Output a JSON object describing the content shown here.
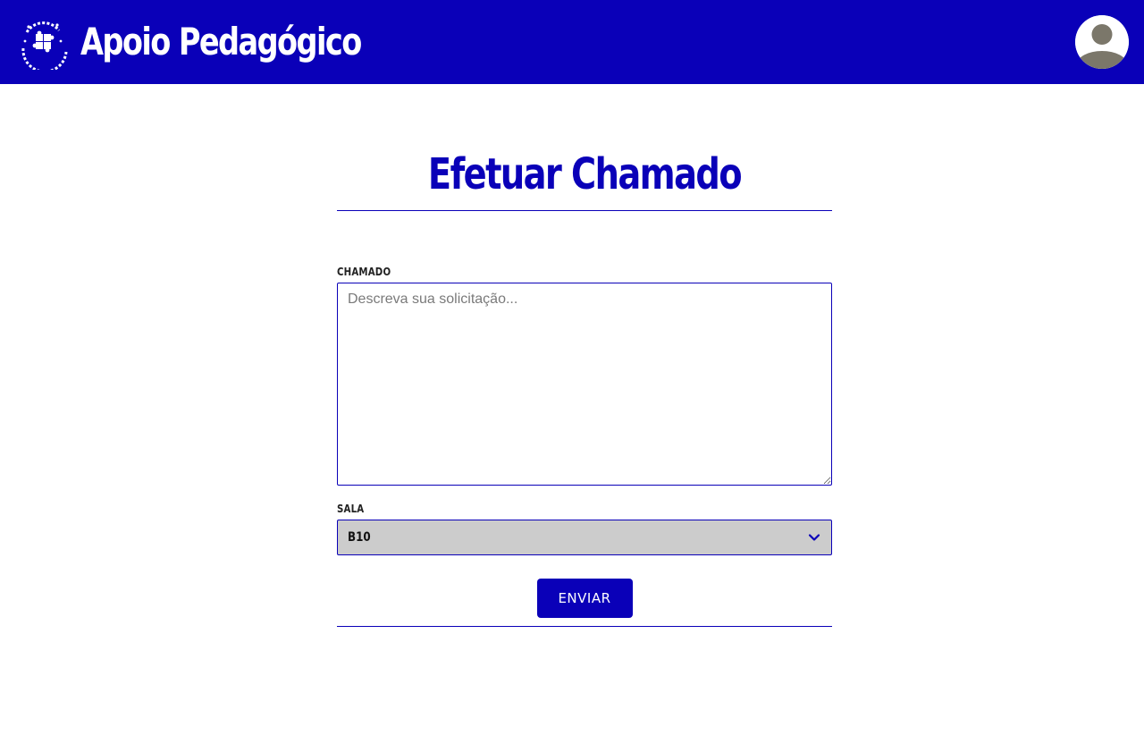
{
  "header": {
    "app_title": "Apoio Pedagógico",
    "logo_icon": "puzzle-logo-icon",
    "avatar_icon": "user-avatar-icon",
    "brand_color": "#0a00b8"
  },
  "form": {
    "title": "Efetuar Chamado",
    "chamado_label": "CHAMADO",
    "chamado_placeholder": "Descreva sua solicitação...",
    "chamado_value": "",
    "sala_label": "SALA",
    "sala_selected": "B10",
    "submit_label": "ENVIAR"
  }
}
